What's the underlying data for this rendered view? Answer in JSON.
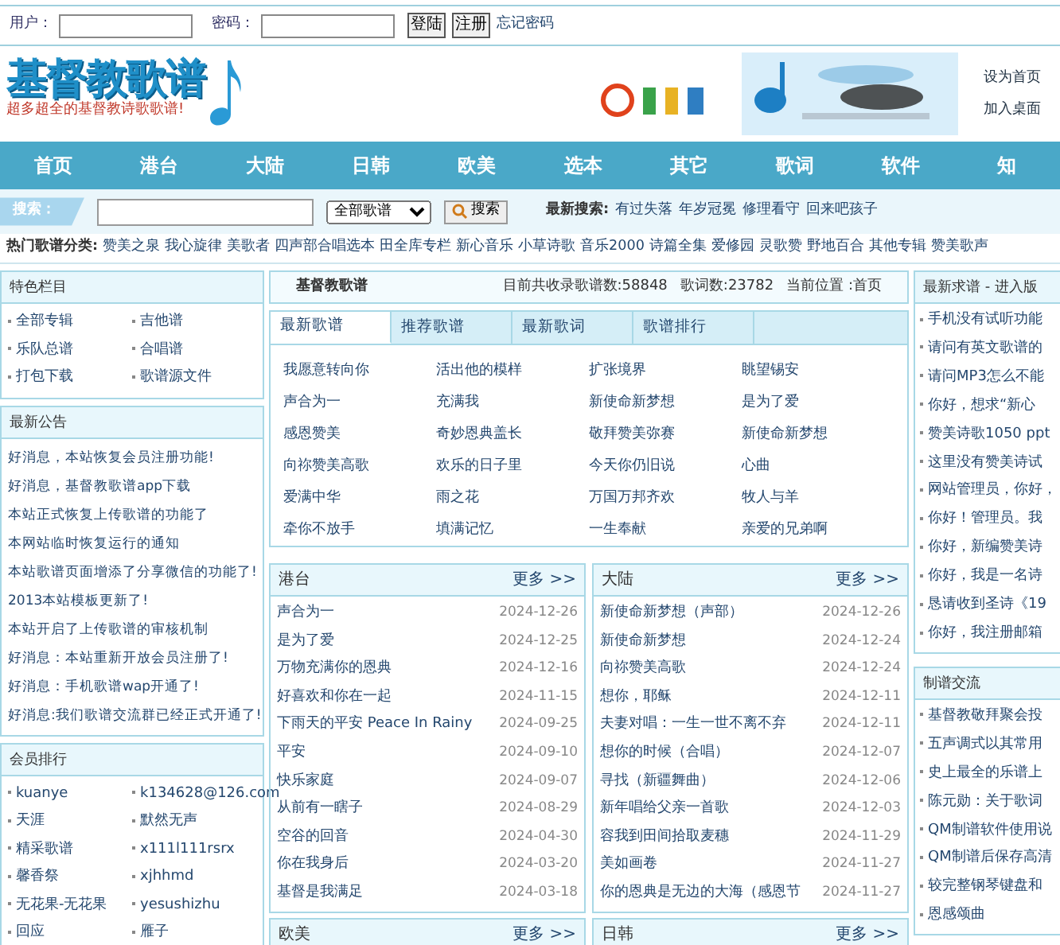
{
  "login": {
    "user_label": "用户：",
    "password_label": "密码：",
    "login_button": "登陆",
    "register_button": "注册",
    "forgot_link": "忘记密码"
  },
  "header": {
    "logo_title": "基督教歌谱",
    "logo_slogan": "超多超全的基督教诗歌歌谱!",
    "banner": {
      "kind": "picture"
    },
    "links": [
      "设为首页",
      "加入桌面"
    ]
  },
  "nav": [
    "首页",
    "港台",
    "大陆",
    "日韩",
    "欧美",
    "选本",
    "其它",
    "歌词",
    "软件",
    "知"
  ],
  "search": {
    "label": "搜索：",
    "scope": "全部歌谱",
    "button": "搜索",
    "latest_label": "最新搜索:",
    "latest": [
      "有过失落",
      "年岁冠冕",
      "修理看守",
      "回来吧孩子"
    ]
  },
  "hot": {
    "label": "热门歌谱分类:",
    "items": [
      "赞美之泉",
      "我心旋律",
      "美歌者",
      "四声部合唱选本",
      "田全库专栏",
      "新心音乐",
      "小草诗歌",
      "音乐2000",
      "诗篇全集",
      "爱修园",
      "灵歌赞",
      "野地百合",
      "其他专辑",
      "赞美歌声"
    ]
  },
  "left": [
    {
      "title": "特色栏目",
      "kind": "grid",
      "items": [
        "全部专辑",
        "吉他谱",
        "乐队总谱",
        "合唱谱",
        "打包下载",
        "歌谱源文件"
      ]
    },
    {
      "title": "最新公告",
      "kind": "list",
      "items": [
        "好消息，本站恢复会员注册功能!",
        "好消息，基督教歌谱app下载",
        "本站正式恢复上传歌谱的功能了",
        "本网站临时恢复运行的通知",
        "本站歌谱页面增添了分享微信的功能了!",
        "2013本站模板更新了!",
        "本站开启了上传歌谱的审核机制",
        "好消息：本站重新开放会员注册了!",
        "好消息：手机歌谱wap开通了!",
        "好消息:我们歌谱交流群已经正式开通了!"
      ]
    },
    {
      "title": "会员排行",
      "kind": "grid",
      "items": [
        "kuanye",
        "k134628@126.com",
        "天涯",
        "默然无声",
        "精采歌谱",
        "x111l111rsrx",
        "馨香祭",
        "xjhhmd",
        "无花果-无花果",
        "yesushizhu",
        "回应",
        "雁子"
      ]
    }
  ],
  "main": {
    "title": "基督教歌谱",
    "stats": [
      "目前共收录歌谱数:58848",
      "歌词数:23782",
      "当前位置 :首页"
    ],
    "tabs": [
      {
        "label": "最新歌谱",
        "selected": true
      },
      {
        "label": "推荐歌谱",
        "selected": false
      },
      {
        "label": "最新歌词",
        "selected": false
      },
      {
        "label": "歌谱排行",
        "selected": false
      }
    ],
    "songs": [
      "我愿意转向你",
      "活出他的模样",
      "扩张境界",
      "眺望锡安",
      "声合为一",
      "充满我",
      "新使命新梦想",
      "是为了爱",
      "感恩赞美",
      "奇妙恩典盖长",
      "敬拜赞美弥赛",
      "新使命新梦想",
      "向祢赞美高歌",
      "欢乐的日子里",
      "今天你仍旧说",
      "心曲",
      "爱满中华",
      "雨之花",
      "万国万邦齐欢",
      "牧人与羊",
      "牵你不放手",
      "填满记忆",
      "一生奉献",
      "亲爱的兄弟啊"
    ]
  },
  "panels": [
    {
      "title": "港台",
      "more": "更多 >>",
      "rows": [
        {
          "title": "声合为一",
          "date": "2024-12-26"
        },
        {
          "title": "是为了爱",
          "date": "2024-12-25"
        },
        {
          "title": "万物充满你的恩典",
          "date": "2024-12-16"
        },
        {
          "title": "好喜欢和你在一起",
          "date": "2024-11-15"
        },
        {
          "title": "下雨天的平安 Peace In Rainy",
          "date": "2024-09-25"
        },
        {
          "title": "平安",
          "date": "2024-09-10"
        },
        {
          "title": "快乐家庭",
          "date": "2024-09-07"
        },
        {
          "title": "从前有一瞎子",
          "date": "2024-08-29"
        },
        {
          "title": "空谷的回音",
          "date": "2024-04-30"
        },
        {
          "title": "你在我身后",
          "date": "2024-03-20"
        },
        {
          "title": "基督是我满足",
          "date": "2024-03-18"
        }
      ]
    },
    {
      "title": "大陆",
      "more": "更多 >>",
      "rows": [
        {
          "title": "新使命新梦想（声部）",
          "date": "2024-12-26"
        },
        {
          "title": "新使命新梦想",
          "date": "2024-12-24"
        },
        {
          "title": "向祢赞美高歌",
          "date": "2024-12-24"
        },
        {
          "title": "想你，耶稣",
          "date": "2024-12-11"
        },
        {
          "title": "夫妻对唱：一生一世不离不弃",
          "date": "2024-12-11"
        },
        {
          "title": "想你的时候（合唱）",
          "date": "2024-12-07"
        },
        {
          "title": "寻找（新疆舞曲）",
          "date": "2024-12-06"
        },
        {
          "title": "新年唱给父亲一首歌",
          "date": "2024-12-03"
        },
        {
          "title": "容我到田间拾取麦穗",
          "date": "2024-11-29"
        },
        {
          "title": "美如画卷",
          "date": "2024-11-27"
        },
        {
          "title": "你的恩典是无边的大海（感恩节",
          "date": "2024-11-27"
        }
      ]
    },
    {
      "title": "欧美",
      "more": "更多 >>"
    },
    {
      "title": "日韩",
      "more": "更多 >>"
    }
  ],
  "right": [
    {
      "title": "最新求谱 - 进入版",
      "items": [
        "手机没有试听功能",
        "请问有英文歌谱的",
        "请问MP3怎么不能",
        "你好，想求“新心",
        "赞美诗歌1050 ppt",
        "这里没有赞美诗试",
        "网站管理员，你好，",
        "你好！管理员。我",
        "你好，新编赞美诗",
        "你好，我是一名诗",
        "恳请收到圣诗《19",
        "你好，我注册邮箱"
      ]
    },
    {
      "title": "制谱交流",
      "items": [
        "基督教敬拜聚会投",
        "五声调式以其常用",
        "史上最全的乐谱上",
        "陈元勋：关于歌词",
        "QM制谱软件使用说",
        "QM制谱后保存高清",
        "较完整钢琴键盘和",
        "恩感颂曲"
      ]
    }
  ]
}
